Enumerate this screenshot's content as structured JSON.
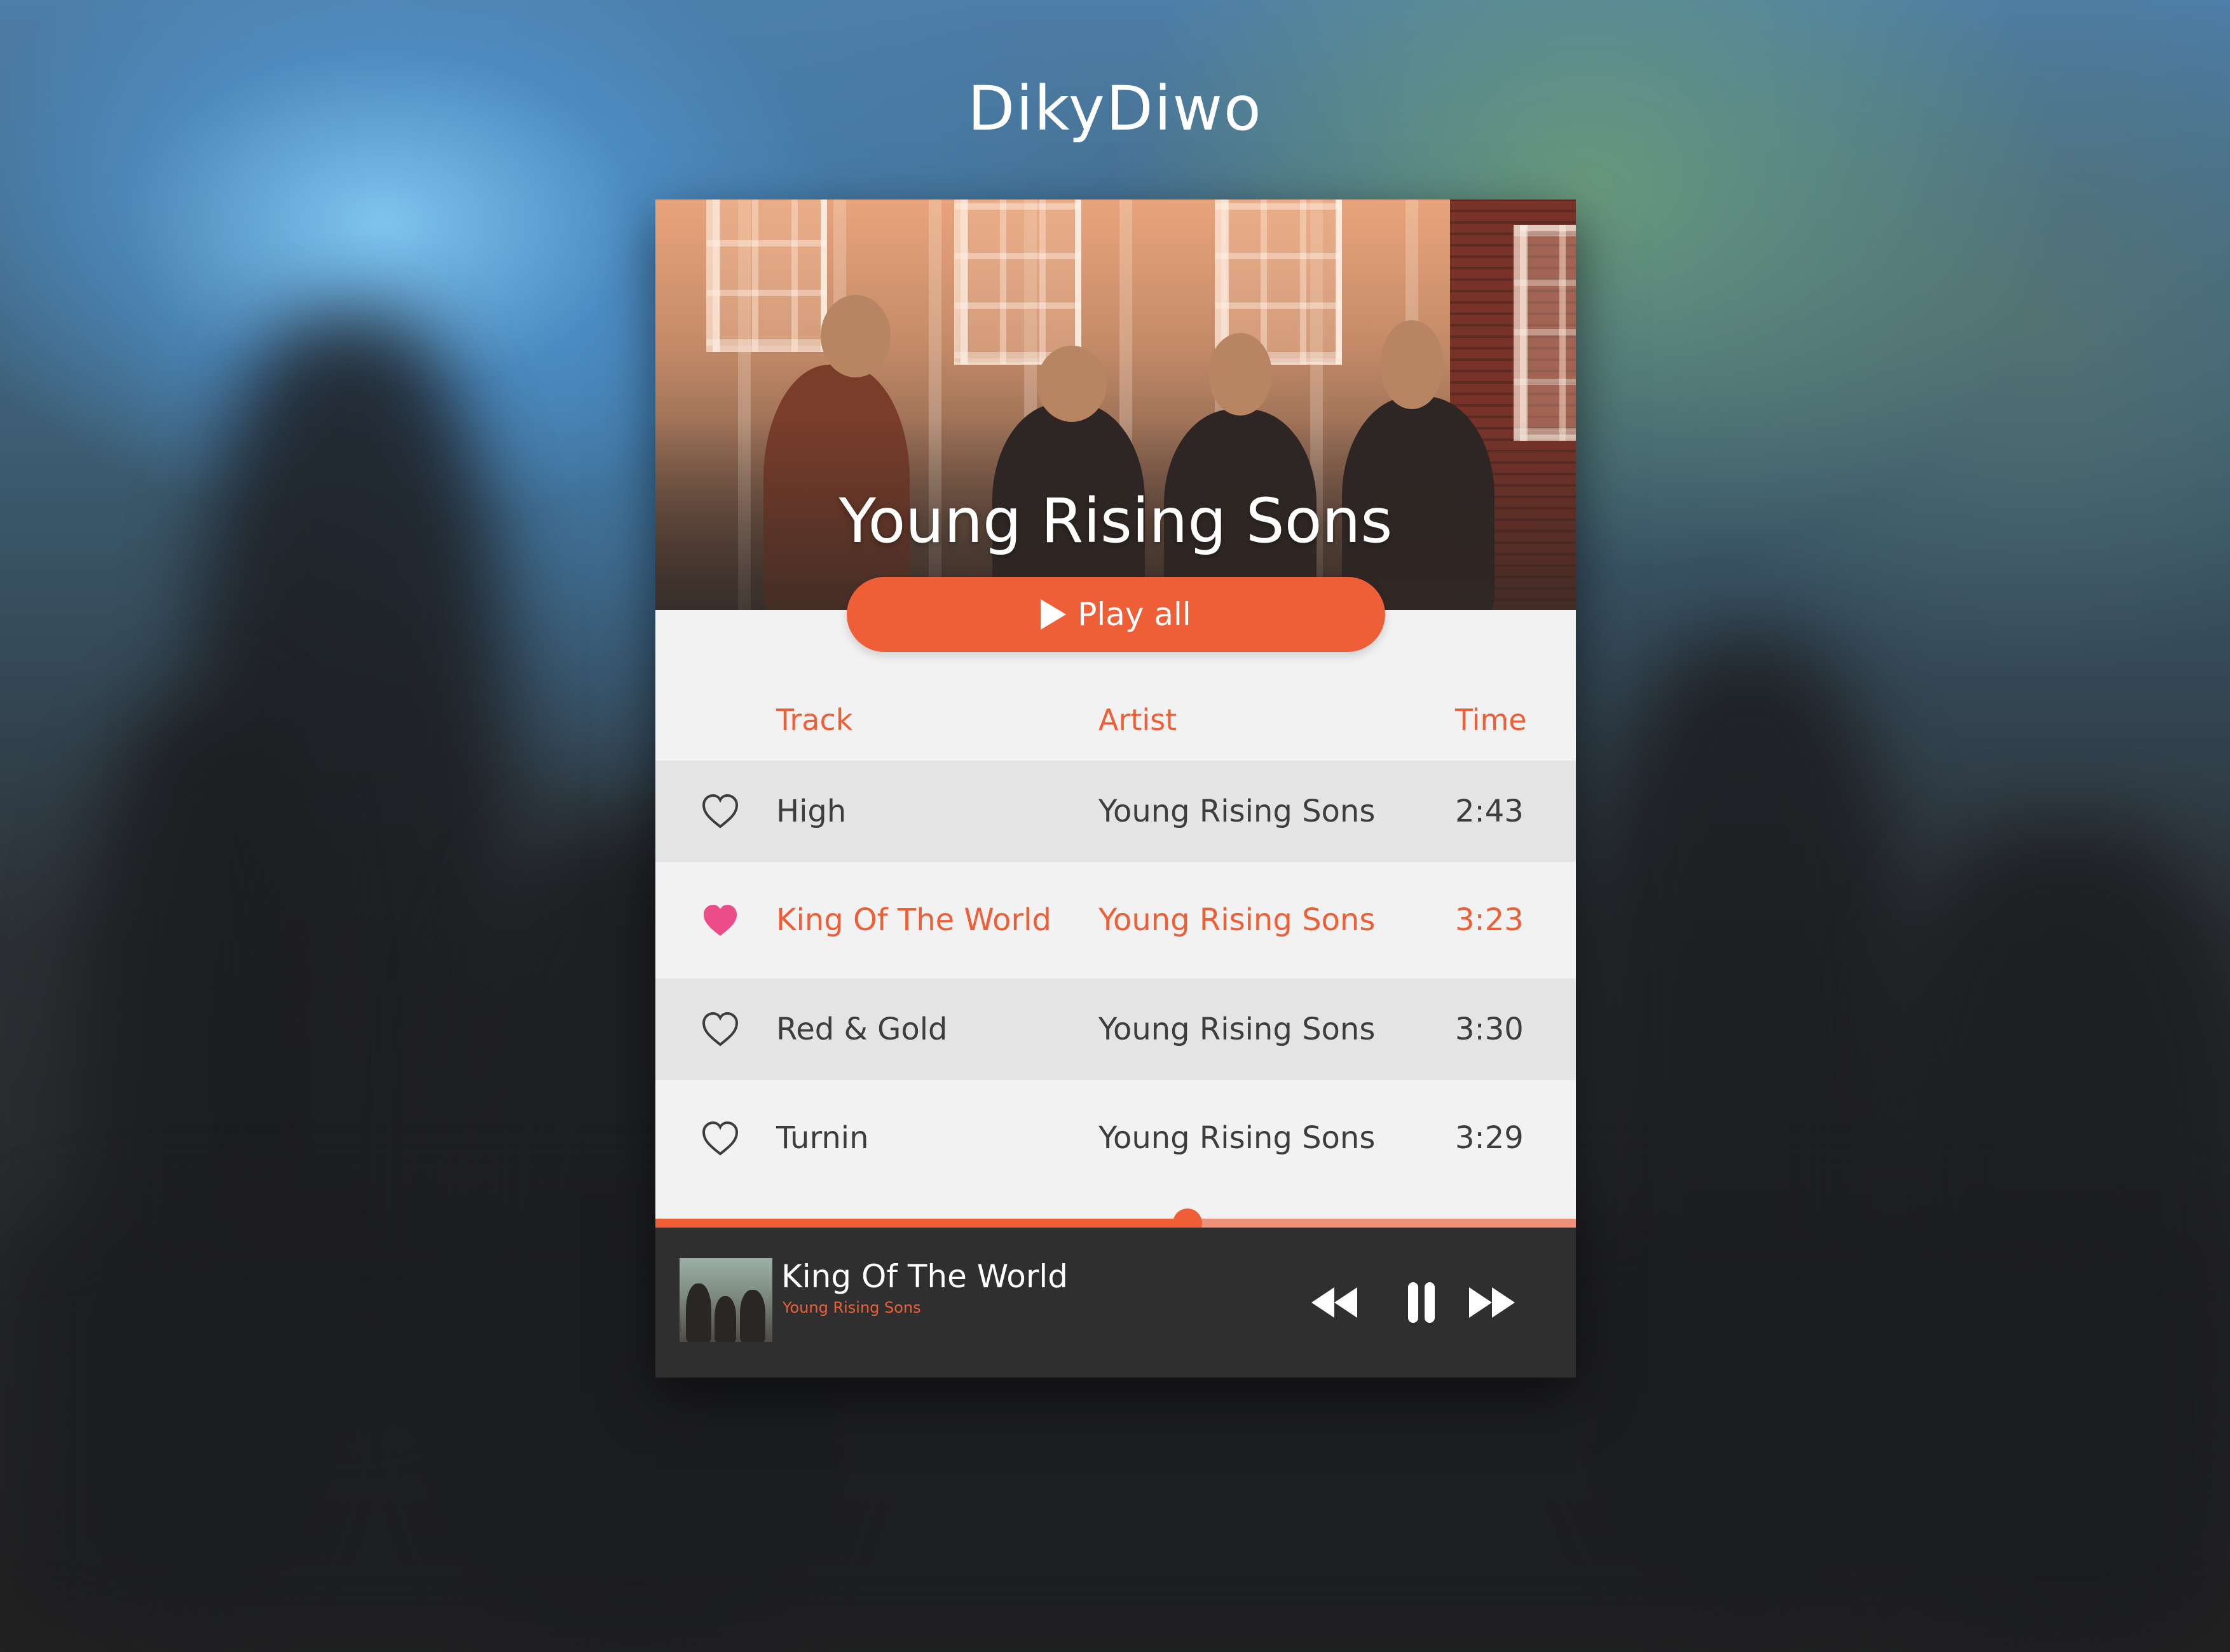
{
  "brand": {
    "name": "DikyDiwo"
  },
  "album": {
    "artist_title": "Young Rising Sons"
  },
  "play_all": {
    "label": "Play all"
  },
  "table": {
    "headers": {
      "track": "Track",
      "artist": "Artist",
      "time": "Time"
    },
    "rows": [
      {
        "track": "High",
        "artist": "Young Rising Sons",
        "time": "2:43",
        "liked": false,
        "active": false
      },
      {
        "track": "King Of The World",
        "artist": "Young Rising Sons",
        "time": "3:23",
        "liked": true,
        "active": true
      },
      {
        "track": "Red & Gold",
        "artist": "Young Rising Sons",
        "time": "3:30",
        "liked": false,
        "active": false
      },
      {
        "track": "Turnin",
        "artist": "Young Rising Sons",
        "time": "3:29",
        "liked": false,
        "active": false
      }
    ]
  },
  "player": {
    "now_playing_title": "King Of The World",
    "now_playing_artist": "Young Rising Sons",
    "progress": 0.578,
    "state": "playing",
    "controls": [
      "rewind-icon",
      "pause-icon",
      "fast-forward-icon"
    ]
  },
  "colors": {
    "accent": "#ef5f37",
    "heart_active": "#ec4d88",
    "row_shade": "#e4e4e4",
    "card_bg": "#f2f2f2",
    "player_bg": "#2f2f2f"
  }
}
